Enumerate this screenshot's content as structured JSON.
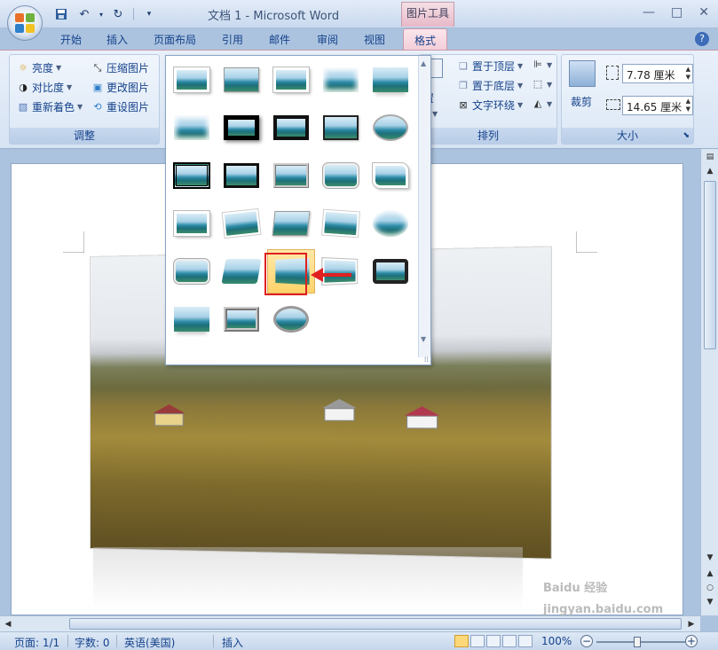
{
  "title_bar": {
    "document_title": "文档 1 - Microsoft Word",
    "context_tool": "图片工具",
    "buttons": [
      "minimize-icon",
      "maximize-icon",
      "close-icon"
    ]
  },
  "quick_access": {
    "save": "save-icon",
    "undo": "undo-icon",
    "redo": "redo-icon",
    "customize": "▾"
  },
  "tabs": [
    {
      "label": "开始"
    },
    {
      "label": "插入"
    },
    {
      "label": "页面布局"
    },
    {
      "label": "引用"
    },
    {
      "label": "邮件"
    },
    {
      "label": "审阅"
    },
    {
      "label": "视图"
    },
    {
      "label": "格式",
      "active": true
    }
  ],
  "ribbon": {
    "adjust": {
      "label": "调整",
      "brightness": "亮度",
      "contrast": "对比度",
      "recolor": "重新着色",
      "compress": "压缩图片",
      "change": "更改图片",
      "reset": "重设图片"
    },
    "arrange": {
      "label": "排列",
      "position_partial": "置",
      "bring_front": "置于顶层",
      "send_back": "置于底层",
      "text_wrap": "文字环绕"
    },
    "size": {
      "label": "大小",
      "crop": "裁剪",
      "height": "7.78 厘米",
      "width": "14.65 厘米"
    }
  },
  "picture_styles_gallery": {
    "rows": [
      [
        "simple-frame-white",
        "soft-edge",
        "drop-shadow",
        "metal-frame",
        "reflected-rounded"
      ],
      [
        "soft-edge-rect",
        "thick-black-frame",
        "black-frame-shadow",
        "simple-black",
        "oval-reflected"
      ],
      [
        "double-frame-black",
        "thin-black-frame",
        "bevel-rect",
        "rounded-diagonal",
        "snip-diagonal"
      ],
      [
        "center-shadow",
        "rotated-white",
        "perspective-shadow",
        "relaxed-perspective",
        "soft-edge-oval"
      ],
      [
        "bevel-rounded",
        "moderate-frame",
        "perspective-left-reflected",
        "perspective-right",
        "metal-rounded"
      ],
      [
        "reflected-bevel",
        "compound-frame",
        "metal-oval"
      ]
    ],
    "selected": "perspective-left-reflected"
  },
  "status_bar": {
    "page": "页面: 1/1",
    "words": "字数: 0",
    "language": "英语(美国)",
    "mode": "插入",
    "zoom": "100%",
    "zoom_level_percent": 100
  },
  "watermark": "Baidu 经验 jingyan.baidu.com"
}
